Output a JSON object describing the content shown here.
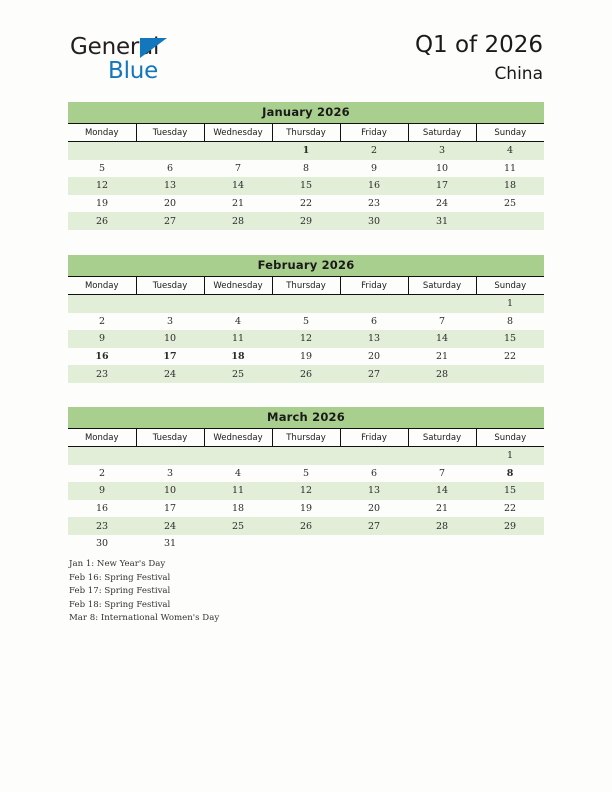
{
  "brand": {
    "name_part1": "General",
    "name_part2": "Blue",
    "triangle_color": "#1277bc"
  },
  "header": {
    "title": "Q1 of 2026",
    "subtitle": "China"
  },
  "colors": {
    "month_header_bg": "#a9cf8f",
    "row_stripe_bg": "#e2eed8",
    "holiday_text": "#ee1b22",
    "page_bg": "#fdfdfc"
  },
  "weekdays": [
    "Monday",
    "Tuesday",
    "Wednesday",
    "Thursday",
    "Friday",
    "Saturday",
    "Sunday"
  ],
  "months": [
    {
      "title": "January 2026",
      "weeks": [
        [
          "",
          "",
          "",
          "1",
          "2",
          "3",
          "4"
        ],
        [
          "5",
          "6",
          "7",
          "8",
          "9",
          "10",
          "11"
        ],
        [
          "12",
          "13",
          "14",
          "15",
          "16",
          "17",
          "18"
        ],
        [
          "19",
          "20",
          "21",
          "22",
          "23",
          "24",
          "25"
        ],
        [
          "26",
          "27",
          "28",
          "29",
          "30",
          "31",
          ""
        ]
      ],
      "holidays": [
        "1"
      ]
    },
    {
      "title": "February 2026",
      "weeks": [
        [
          "",
          "",
          "",
          "",
          "",
          "",
          "1"
        ],
        [
          "2",
          "3",
          "4",
          "5",
          "6",
          "7",
          "8"
        ],
        [
          "9",
          "10",
          "11",
          "12",
          "13",
          "14",
          "15"
        ],
        [
          "16",
          "17",
          "18",
          "19",
          "20",
          "21",
          "22"
        ],
        [
          "23",
          "24",
          "25",
          "26",
          "27",
          "28",
          ""
        ]
      ],
      "holidays": [
        "16",
        "17",
        "18"
      ]
    },
    {
      "title": "March 2026",
      "weeks": [
        [
          "",
          "",
          "",
          "",
          "",
          "",
          "1"
        ],
        [
          "2",
          "3",
          "4",
          "5",
          "6",
          "7",
          "8"
        ],
        [
          "9",
          "10",
          "11",
          "12",
          "13",
          "14",
          "15"
        ],
        [
          "16",
          "17",
          "18",
          "19",
          "20",
          "21",
          "22"
        ],
        [
          "23",
          "24",
          "25",
          "26",
          "27",
          "28",
          "29"
        ],
        [
          "30",
          "31",
          "",
          "",
          "",
          "",
          ""
        ]
      ],
      "holidays": [
        "8"
      ]
    }
  ],
  "legend": [
    "Jan 1: New Year's Day",
    "Feb 16: Spring Festival",
    "Feb 17: Spring Festival",
    "Feb 18: Spring Festival",
    "Mar 8: International Women's Day"
  ]
}
